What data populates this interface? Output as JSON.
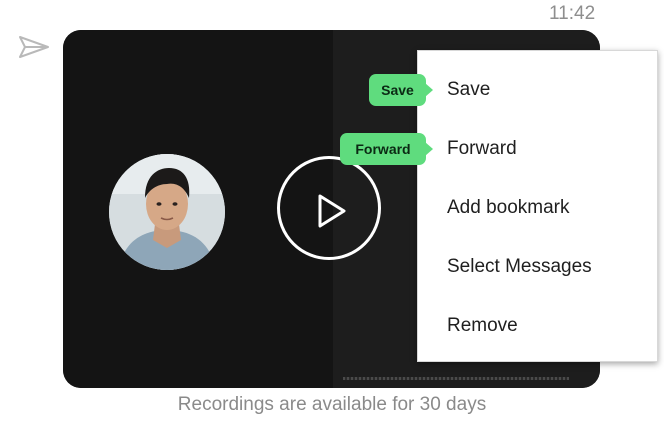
{
  "message": {
    "timestamp": "11:42",
    "status_icon": "sent-icon",
    "caption": "Recordings are available for 30 days"
  },
  "video": {
    "play_icon": "play-icon",
    "avatar_icon": "avatar"
  },
  "context_menu": {
    "items": [
      {
        "label": "Save",
        "shortcut_tip": "Save"
      },
      {
        "label": "Forward",
        "shortcut_tip": "Forward"
      },
      {
        "label": "Add bookmark"
      },
      {
        "label": "Select Messages"
      },
      {
        "label": "Remove"
      }
    ]
  },
  "colors": {
    "video_bg": "#141414",
    "tip_bg": "#5fdc7e",
    "text_muted": "#8a8a8a"
  }
}
